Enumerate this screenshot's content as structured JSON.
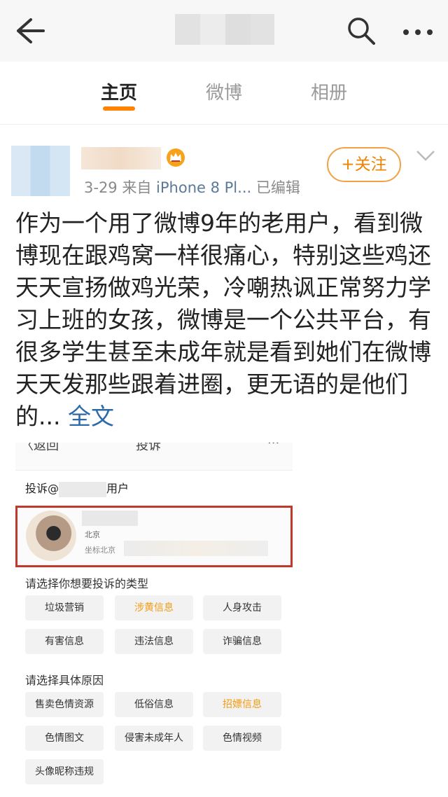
{
  "header": {
    "back_icon": "back-arrow-icon",
    "search_icon": "search-icon",
    "more_icon": "more-icon"
  },
  "tabs": [
    {
      "label": "主页",
      "active": true
    },
    {
      "label": "微博",
      "active": false
    },
    {
      "label": "相册",
      "active": false
    }
  ],
  "post": {
    "date": "3-29",
    "source_prefix": "来自",
    "source": "iPhone 8 Pl...",
    "edited": "已编辑",
    "follow_label": "+关注",
    "text": "作为一个用了微博9年的老用户，看到微博现在跟鸡窝一样很痛心，特别这些鸡还天天宣扬做鸡光荣，冷嘲热讽正常努力学习上班的女孩，微博是一个公共平台，有很多学生甚至未成年就是看到她们在微博天天发那些跟着进圈，更无语的是他们的...",
    "full_text_link": "全文"
  },
  "screenshot": {
    "top_back": "〈返回",
    "top_title": "投诉",
    "top_more": "···",
    "report_prefix": "投诉@",
    "report_suffix": "用户",
    "user_city": "北京",
    "user_location": "坐标北京",
    "type_prompt": "请选择你想要投诉的类型",
    "types": [
      {
        "label": "垃圾营销",
        "highlight": false
      },
      {
        "label": "涉黄信息",
        "highlight": true
      },
      {
        "label": "人身攻击",
        "highlight": false
      },
      {
        "label": "有害信息",
        "highlight": false
      },
      {
        "label": "违法信息",
        "highlight": false
      },
      {
        "label": "诈骗信息",
        "highlight": false
      }
    ],
    "reason_prompt": "请选择具体原因",
    "reasons": [
      {
        "label": "售卖色情资源",
        "highlight": false
      },
      {
        "label": "低俗信息",
        "highlight": false
      },
      {
        "label": "招嫖信息",
        "highlight": true
      },
      {
        "label": "色情图文",
        "highlight": false
      },
      {
        "label": "侵害未成年人",
        "highlight": false
      },
      {
        "label": "色情视频",
        "highlight": false
      },
      {
        "label": "头像昵称违规",
        "highlight": false
      }
    ]
  },
  "colors": {
    "accent": "#ff8200",
    "link": "#2d6aa8",
    "highlight_chip": "#f39c12",
    "frame_red": "#c0392b"
  }
}
